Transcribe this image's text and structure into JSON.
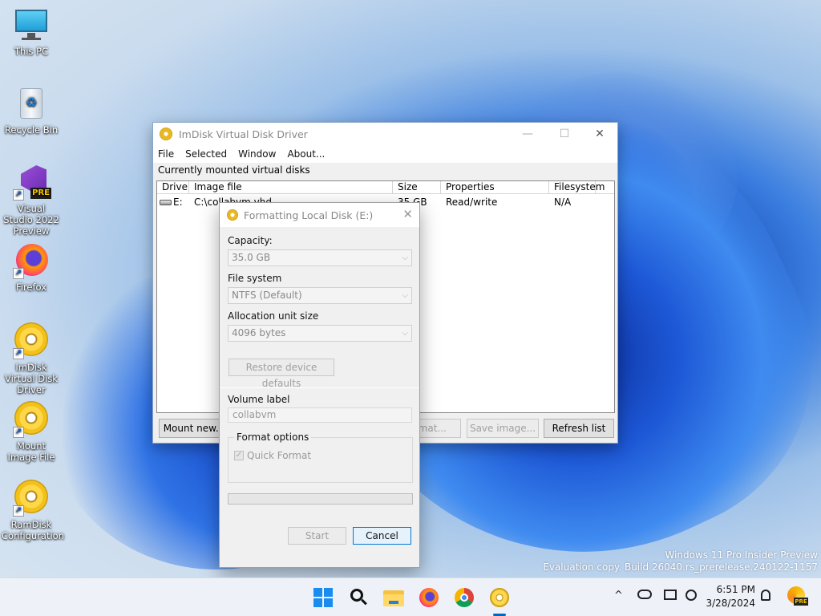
{
  "desktop": {
    "icons": [
      {
        "label": "This PC",
        "icon": "monitor-icon"
      },
      {
        "label": "Recycle Bin",
        "icon": "recycle-bin-icon"
      },
      {
        "label": "Visual Studio 2022 Preview",
        "icon": "visual-studio-icon",
        "badge": "PRE"
      },
      {
        "label": "Firefox",
        "icon": "firefox-icon"
      },
      {
        "label": "ImDisk Virtual Disk Driver",
        "icon": "disc-icon"
      },
      {
        "label": "Mount Image File",
        "icon": "disc-icon"
      },
      {
        "label": "RamDisk Configuration",
        "icon": "disc-icon"
      }
    ],
    "shortcut_arrow": "↗",
    "watermark_line1": "Windows 11 Pro Insider Preview",
    "watermark_line2": "Evaluation copy. Build 26040.rs_prerelease.240122-1157"
  },
  "imdisk": {
    "title": "ImDisk Virtual Disk Driver",
    "menu": [
      "File",
      "Selected",
      "Window",
      "About..."
    ],
    "subhead": "Currently mounted virtual disks",
    "columns": [
      "Drive",
      "Image file",
      "Size",
      "Properties",
      "Filesystem"
    ],
    "rows": [
      {
        "drive": "E:",
        "image": "C:\\collabvm.vhd",
        "size": "35 GB",
        "properties": "Read/write",
        "filesystem": "N/A"
      }
    ],
    "buttons": {
      "mount": "Mount new...",
      "format": "Format...",
      "save": "Save image...",
      "refresh": "Refresh list"
    },
    "controls": {
      "minimize": "—",
      "maximize": "☐",
      "close": "✕"
    }
  },
  "format_dialog": {
    "title": "Formatting Local Disk (E:)",
    "close": "✕",
    "capacity_label": "Capacity:",
    "capacity_value": "35.0 GB",
    "filesystem_label": "File system",
    "filesystem_value": "NTFS (Default)",
    "allocation_label": "Allocation unit size",
    "allocation_value": "4096 bytes",
    "restore_defaults": "Restore device defaults",
    "volume_label_label": "Volume label",
    "volume_label_value": "collabvm",
    "format_options_label": "Format options",
    "quick_format_label": "Quick Format",
    "quick_format_checked": true,
    "progress": 0,
    "start": "Start",
    "cancel": "Cancel",
    "dropdown_arrow": "⌵"
  },
  "taskbar": {
    "apps": [
      "start-icon",
      "search-icon",
      "file-explorer-icon",
      "firefox-icon",
      "chrome-icon",
      "imdisk-icon"
    ],
    "tray_chevron": "^",
    "time": "6:51 PM",
    "date": "3/28/2024",
    "copilot_badge": "PRE"
  }
}
